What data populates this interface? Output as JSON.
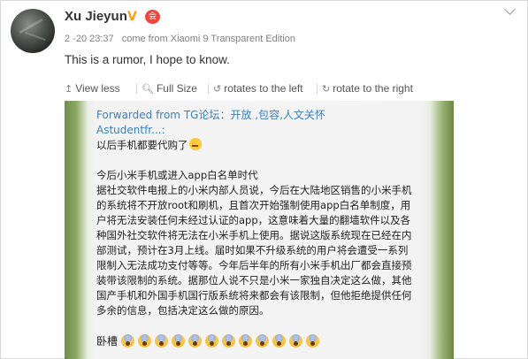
{
  "post": {
    "username": "Xu Jieyun",
    "verified_badge": "V",
    "member_badge": "会",
    "timestamp": "2 -20 23:37",
    "source": "come from Xiaomi 9 Transparent Edition",
    "text": "This is a rumor, I hope to know."
  },
  "toolbar": {
    "view_less": "View less",
    "full_size": "Full Size",
    "rotate_left": "rotates to the left",
    "rotate_right": "rotate to the right"
  },
  "icons": {
    "view_less": "arrow-up-icon",
    "full_size": "magnifier-icon",
    "rotate_left": "rotate-left-icon",
    "rotate_right": "rotate-right-icon",
    "menu": "chevron-down-icon"
  },
  "image_content": {
    "forwarded_from": "Forwarded from TG论坛：开放 ,包容,人文关怀",
    "author": "Astudentfr...:",
    "intro": "以后手机都要代购了",
    "body_lines": [
      "今后小米手机或进入app白名单时代",
      "据社交软件电报上的小米内部人员说，今后在大陆地区销售的小米手机",
      "的系统将不开放root和刷机，且首次开始强制使用app白名单制度，用",
      "户将无法安装任何未经过认证的app，这意味着大量的翻墙软件以及各",
      "种国外社交软件将无法在小米手机上使用。据说这版系统现在已经在内",
      "部测试，预计在3月上线。届时如果不升级系统的用户将会遭受一系列",
      "限制入无法成功支付等等。今年后半年的所有小米手机出厂都会直接预",
      "装带该限制的系统。据那位人说不只是小米一家独自决定这么做，其他",
      "国产手机和外国手机国行版系统将来都会有该限制，但他拒绝提供任何",
      "多余的信息，包括决定这么做的原因。"
    ],
    "closing": "卧槽",
    "scream_count": 12
  },
  "colors": {
    "username": "#333333",
    "meta": "#808080",
    "link_blue": "#3a7fc1",
    "verified": "#ff9e19",
    "member": "#f0453c"
  }
}
